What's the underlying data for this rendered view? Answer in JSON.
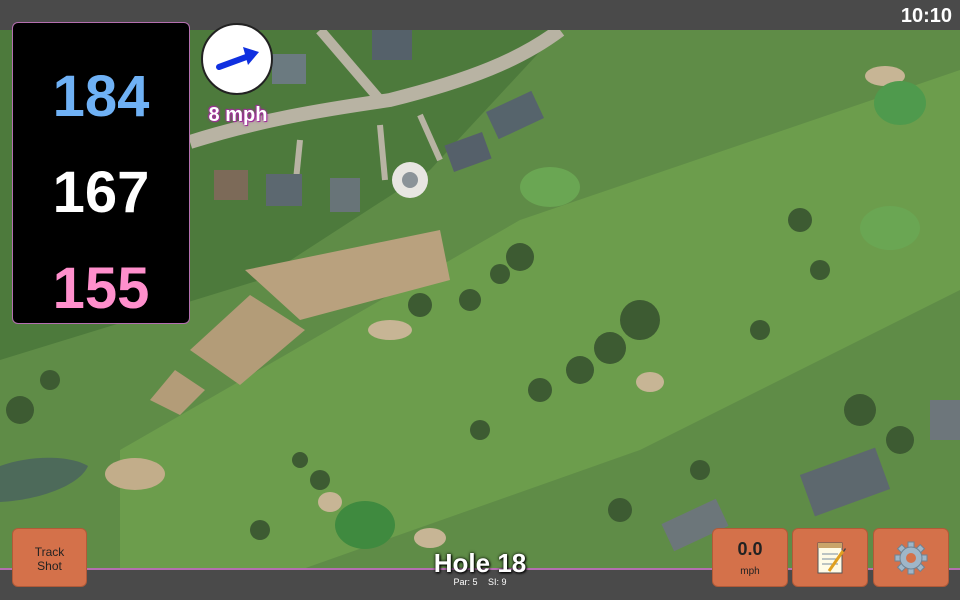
{
  "status": {
    "time": "10:10"
  },
  "distances": {
    "back": "184",
    "middle": "167",
    "front": "155"
  },
  "wind": {
    "speed_label": "8 mph",
    "direction_icon": "arrow-icon"
  },
  "hole": {
    "title": "Hole 18",
    "par": "Par: 5",
    "si": "SI: 9"
  },
  "buttons": {
    "track_shot_line1": "Track",
    "track_shot_line2": "Shot",
    "wind_value": "0.0",
    "wind_unit": "mph",
    "notes_icon": "notepad-icon",
    "settings_icon": "gear-icon"
  },
  "colors": {
    "back_tee": "#6fb1f5",
    "middle_tee": "#ffffff",
    "front_tee": "#ff8fcc",
    "button": "#d4714a",
    "accent_border": "#b46fb0"
  }
}
